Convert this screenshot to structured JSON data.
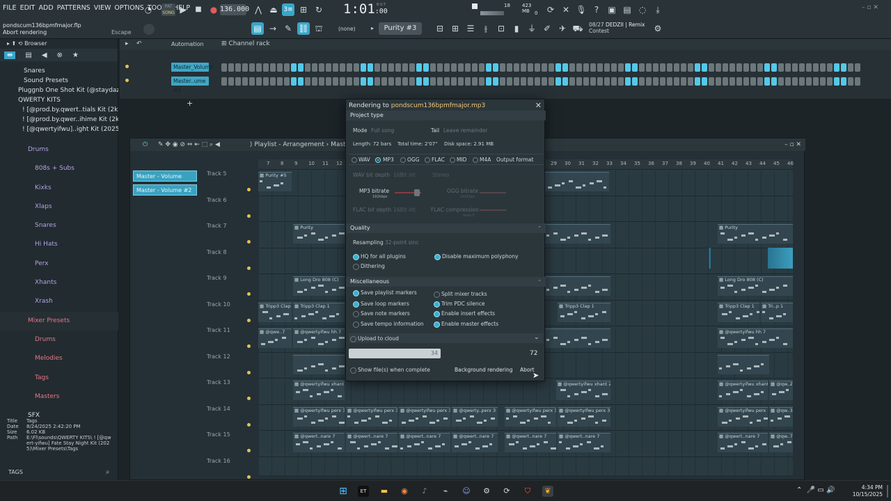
{
  "menu": [
    "FILE",
    "EDIT",
    "ADD",
    "PATTERNS",
    "VIEW",
    "OPTIONS",
    "TOOLS",
    "HELP"
  ],
  "transport": {
    "mode": "SONG",
    "tempo": "136.000",
    "time": "1:01",
    "time_sub": ":00",
    "time_label": "B:S:T"
  },
  "cpu": {
    "cpu_count": "18",
    "ram": "423 MB",
    "voices": "0"
  },
  "hint": {
    "line1_num": "08/27",
    "line1": "DEDZII | Remix",
    "line2": "Contest"
  },
  "project": {
    "file": "pondscum136bpmfmajor.flp",
    "status": "Abort rendering",
    "escape": "Escape"
  },
  "toolbar2": {
    "pattern_none": "(none)",
    "pattern": "Purity #3"
  },
  "browser": {
    "title": "Browser",
    "items": [
      "Snares",
      "Sound Presets",
      "Pluggnb One Shot Kit (@staydazrin)",
      "QWERTY KITS",
      "! [@prod.by.qwert..tials Kit (2k24)",
      "! [@prod.by.qwer..ihime Kit (2k24)",
      "! [@qwertyifwu]..ight Kit (2025)",
      "Drums",
      "808s + Subs",
      "Kixks",
      "Xlaps",
      "Snares",
      "Hi Hats",
      "Perx",
      "Xhants",
      "Xrash",
      "Mixer Presets",
      "Drums",
      "Melodies",
      "Tags",
      "Masters",
      "SFX"
    ],
    "info": {
      "title_label": "Title",
      "title": "Tags",
      "date_label": "Date",
      "date": "8/24/2025 2:42:20 PM",
      "size_label": "Size",
      "size": "6.02 KB",
      "path_label": "Path",
      "path": "E:\\Fl\\sounds\\QWERTY KITS\\ ! [@qwert-yifwu] Fate Stay Night Kit (2025)\\Mixer Presets\\Tags"
    },
    "tags": "TAGS"
  },
  "channel_rack": {
    "automation": "Automation",
    "title": "Channel rack",
    "channels": [
      "Master_Volume",
      "Master..ume #2"
    ]
  },
  "playlist": {
    "title": "Playlist - Arrangement",
    "title_suffix": "Mast",
    "pattern_channels": [
      "Master - Volume",
      "Master - Volume #2"
    ],
    "tracks": [
      "Track 5",
      "Track 6",
      "Track 7",
      "Track 8",
      "Track 9",
      "Track 10",
      "Track 11",
      "Track 12",
      "Track 13",
      "Track 14",
      "Track 15",
      "Track 16"
    ],
    "ruler": [
      "7",
      "8",
      "9",
      "10",
      "11",
      "12",
      "29",
      "30",
      "31",
      "32",
      "33",
      "34",
      "35",
      "36",
      "37",
      "38",
      "39",
      "40",
      "41",
      "42",
      "43",
      "44",
      "45",
      "46"
    ],
    "clips": {
      "purity5": "Purity #5",
      "purity": "Purity",
      "long808": "Long Dro 808 (C)",
      "trippclap": "Tripp3 Clap 1",
      "hh7": "@qwertyifwu hh 7",
      "hh7short": "@qwe..7",
      "xhant2": "@qwertyifwu xhant 2",
      "perx3": "@qwertyifwu perx 3",
      "perxshort": "@qwerty..perx 3",
      "snare7": "@qwert..nare 7",
      "xhantshort": "@qw..2",
      "perxtiny": "@qw..3",
      "snaretiny": "@qw..7",
      "trp": "Tri..p 1"
    }
  },
  "render": {
    "title_prefix": "Rendering to",
    "filename": "pondscum136bpmfmajor.mp3",
    "sections": {
      "project_type": "Project type",
      "quality": "Quality",
      "misc": "Miscellaneous"
    },
    "mode_label": "Mode",
    "mode": "Full song",
    "tail_label": "Tail",
    "tail": "Leave remainder",
    "length": "Length: 72 bars",
    "total_time": "Total time: 2'07\"",
    "disk_space": "Disk space: 2.91 MB",
    "formats": [
      "WAV",
      "MP3",
      "OGG",
      "FLAC",
      "MID",
      "M4A"
    ],
    "selected_format": "MP3",
    "output_format": "Output format",
    "wav_bit_depth_label": "WAV bit depth",
    "wav_bit_depth": "16Bit int",
    "wav_stereo": "Stereo",
    "mp3_bitrate_label": "MP3 bitrate",
    "mp3_bitrate": "192kbps",
    "ogg_bitrate_label": "OGG bitrate",
    "ogg_bitrate": "192kbps",
    "flac_bit_depth_label": "FLAC bit depth",
    "flac_bit_depth": "16Bit int",
    "flac_compression_label": "FLAC compression",
    "flac_compression": "level 5",
    "resampling_label": "Resampling",
    "resampling": "32-point sinc",
    "quality_opts": [
      {
        "label": "HQ for all plugins",
        "on": true
      },
      {
        "label": "Disable maximum polyphony",
        "on": true
      },
      {
        "label": "Dithering",
        "on": false
      }
    ],
    "misc_opts": [
      {
        "label": "Save playlist markers",
        "on": true
      },
      {
        "label": "Split mixer tracks",
        "on": false
      },
      {
        "label": "Save loop markers",
        "on": true
      },
      {
        "label": "Trim PDC silence",
        "on": true
      },
      {
        "label": "Save note markers",
        "on": false
      },
      {
        "label": "Enable insert effects",
        "on": true
      },
      {
        "label": "Save tempo information",
        "on": false
      },
      {
        "label": "Enable master effects",
        "on": true
      }
    ],
    "upload": "Upload to cloud",
    "progress": {
      "current": "34",
      "total": "72",
      "fraction": 0.472
    },
    "show_files": "Show file(s) when complete",
    "background": "Background rendering",
    "abort": "Abort"
  },
  "taskbar": {
    "time": "4:34 PM",
    "date": "10/15/2025"
  }
}
